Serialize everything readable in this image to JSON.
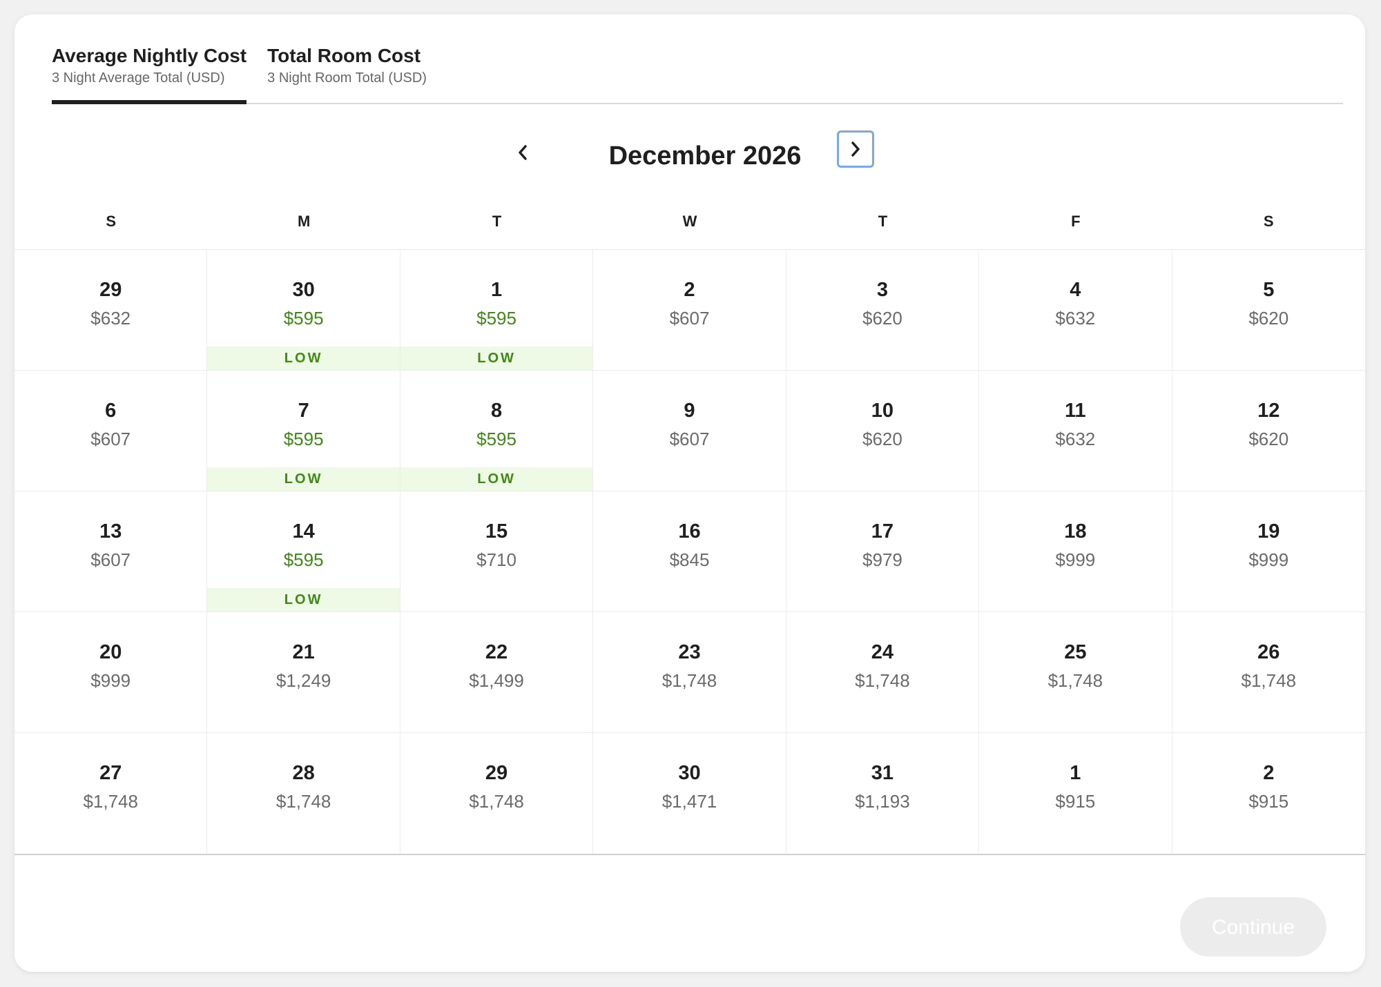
{
  "tabs": [
    {
      "title": "Average Nightly Cost",
      "subtitle": "3 Night Average Total (USD)",
      "active": true
    },
    {
      "title": "Total Room Cost",
      "subtitle": "3 Night Room Total (USD)",
      "active": false
    }
  ],
  "calendar": {
    "month_label": "December 2026",
    "prev_icon": "chevron-left-icon",
    "next_icon": "chevron-right-icon",
    "weekdays": [
      "S",
      "M",
      "T",
      "W",
      "T",
      "F",
      "S"
    ],
    "low_label": "LOW",
    "colors": {
      "low_text": "#3f8a14",
      "low_bg": "#eef9e6",
      "regular_price": "#6b6b6b"
    },
    "days": [
      {
        "day": "29",
        "price": "$632",
        "low": false
      },
      {
        "day": "30",
        "price": "$595",
        "low": true
      },
      {
        "day": "1",
        "price": "$595",
        "low": true
      },
      {
        "day": "2",
        "price": "$607",
        "low": false
      },
      {
        "day": "3",
        "price": "$620",
        "low": false
      },
      {
        "day": "4",
        "price": "$632",
        "low": false
      },
      {
        "day": "5",
        "price": "$620",
        "low": false
      },
      {
        "day": "6",
        "price": "$607",
        "low": false
      },
      {
        "day": "7",
        "price": "$595",
        "low": true
      },
      {
        "day": "8",
        "price": "$595",
        "low": true
      },
      {
        "day": "9",
        "price": "$607",
        "low": false
      },
      {
        "day": "10",
        "price": "$620",
        "low": false
      },
      {
        "day": "11",
        "price": "$632",
        "low": false
      },
      {
        "day": "12",
        "price": "$620",
        "low": false
      },
      {
        "day": "13",
        "price": "$607",
        "low": false
      },
      {
        "day": "14",
        "price": "$595",
        "low": true
      },
      {
        "day": "15",
        "price": "$710",
        "low": false
      },
      {
        "day": "16",
        "price": "$845",
        "low": false
      },
      {
        "day": "17",
        "price": "$979",
        "low": false
      },
      {
        "day": "18",
        "price": "$999",
        "low": false
      },
      {
        "day": "19",
        "price": "$999",
        "low": false
      },
      {
        "day": "20",
        "price": "$999",
        "low": false
      },
      {
        "day": "21",
        "price": "$1,249",
        "low": false
      },
      {
        "day": "22",
        "price": "$1,499",
        "low": false
      },
      {
        "day": "23",
        "price": "$1,748",
        "low": false
      },
      {
        "day": "24",
        "price": "$1,748",
        "low": false
      },
      {
        "day": "25",
        "price": "$1,748",
        "low": false
      },
      {
        "day": "26",
        "price": "$1,748",
        "low": false
      },
      {
        "day": "27",
        "price": "$1,748",
        "low": false
      },
      {
        "day": "28",
        "price": "$1,748",
        "low": false
      },
      {
        "day": "29",
        "price": "$1,748",
        "low": false
      },
      {
        "day": "30",
        "price": "$1,471",
        "low": false
      },
      {
        "day": "31",
        "price": "$1,193",
        "low": false
      },
      {
        "day": "1",
        "price": "$915",
        "low": false
      },
      {
        "day": "2",
        "price": "$915",
        "low": false
      }
    ]
  },
  "footer": {
    "continue_label": "Continue",
    "continue_disabled": true
  }
}
